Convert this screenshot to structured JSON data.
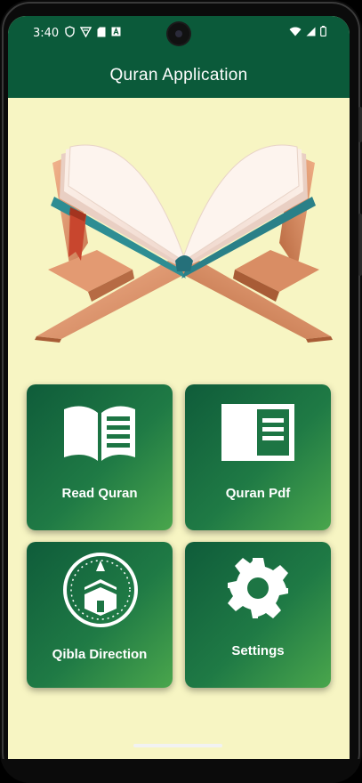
{
  "status_bar": {
    "time": "3:40",
    "left_icons": [
      "shield-icon",
      "vpn-icon",
      "sd-card-icon",
      "notification-a-icon"
    ],
    "right_icons": [
      "wifi-icon",
      "signal-icon",
      "battery-icon"
    ]
  },
  "app_bar": {
    "title": "Quran Application"
  },
  "menu": {
    "items": [
      {
        "label": "Read Quran",
        "icon": "open-book-icon"
      },
      {
        "label": "Quran Pdf",
        "icon": "pdf-document-icon"
      },
      {
        "label": "Qibla Direction",
        "icon": "kaaba-compass-icon"
      },
      {
        "label": "Settings",
        "icon": "gear-icon"
      }
    ]
  },
  "colors": {
    "primary": "#0b5a3a",
    "background": "#f7f5c3",
    "card_gradient_start": "#0f5c3a",
    "card_gradient_end": "#4aa64c"
  }
}
